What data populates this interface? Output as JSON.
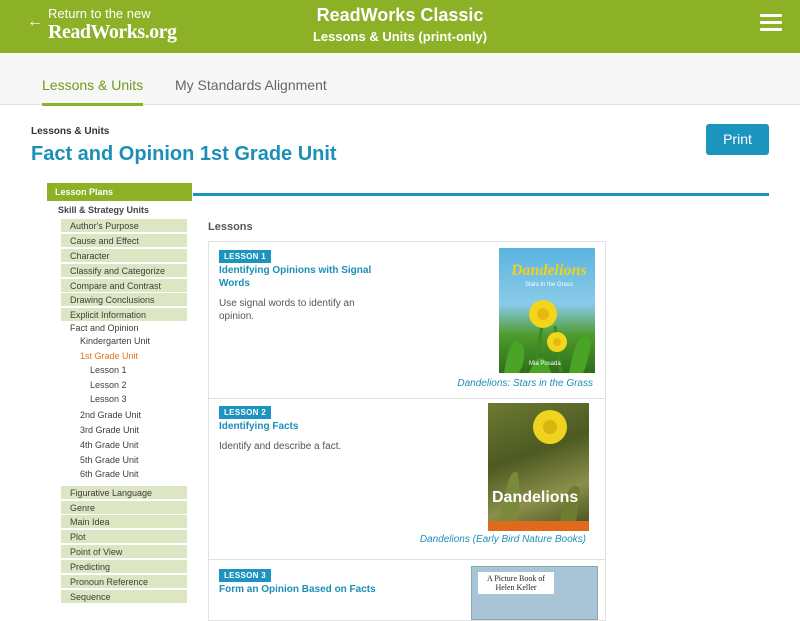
{
  "header": {
    "back_arrow": "←",
    "back_line1": "Return to the new",
    "back_line2": "ReadWorks.org",
    "title": "ReadWorks Classic",
    "subtitle": "Lessons & Units (print-only)"
  },
  "tabs": [
    {
      "label": "Lessons & Units"
    },
    {
      "label": "My Standards Alignment"
    }
  ],
  "page": {
    "breadcrumb": "Lessons & Units",
    "title": "Fact and Opinion 1st Grade Unit",
    "print_label": "Print"
  },
  "sidebar": {
    "header": "Lesson Plans",
    "subheader": "Skill & Strategy Units",
    "items_top": [
      "Author's Purpose",
      "Cause and Effect",
      "Character",
      "Classify and Categorize",
      "Compare and Contrast",
      "Drawing Conclusions",
      "Explicit Information"
    ],
    "current_unit": "Fact and Opinion",
    "grade_units": {
      "k": "Kindergarten Unit",
      "g1": "1st Grade Unit",
      "lessons": [
        "Lesson 1",
        "Lesson 2",
        "Lesson 3"
      ],
      "rest": [
        "2nd Grade Unit",
        "3rd Grade Unit",
        "4th Grade Unit",
        "5th Grade Unit",
        "6th Grade Unit"
      ]
    },
    "items_bottom": [
      "Figurative Language",
      "Genre",
      "Main Idea",
      "Plot",
      "Point of View",
      "Predicting",
      "Pronoun Reference",
      "Sequence"
    ]
  },
  "lessons": {
    "heading": "Lessons",
    "items": [
      {
        "badge": "LESSON 1",
        "title": "Identifying Opinions with Signal Words",
        "desc": "Use signal words to identify an opinion.",
        "book": "Dandelions: Stars in the Grass",
        "cover_title": "Dandelions",
        "cover_sub": "Stars in the Grass",
        "cover_author": "Mia Posada"
      },
      {
        "badge": "LESSON 2",
        "title": "Identifying Facts",
        "desc": "Identify and describe a fact.",
        "book": "Dandelions (Early Bird Nature Books)",
        "cover_title": "Dandelions"
      },
      {
        "badge": "LESSON 3",
        "title": "Form an Opinion Based on Facts",
        "desc": "",
        "book": "",
        "cover_title": "A Picture Book of Helen Keller"
      }
    ]
  },
  "colors": {
    "brand_green": "#8cb026",
    "teal": "#1d93bf",
    "sidebar_item_bg": "#dde6c3",
    "current_orange": "#e2761b"
  }
}
